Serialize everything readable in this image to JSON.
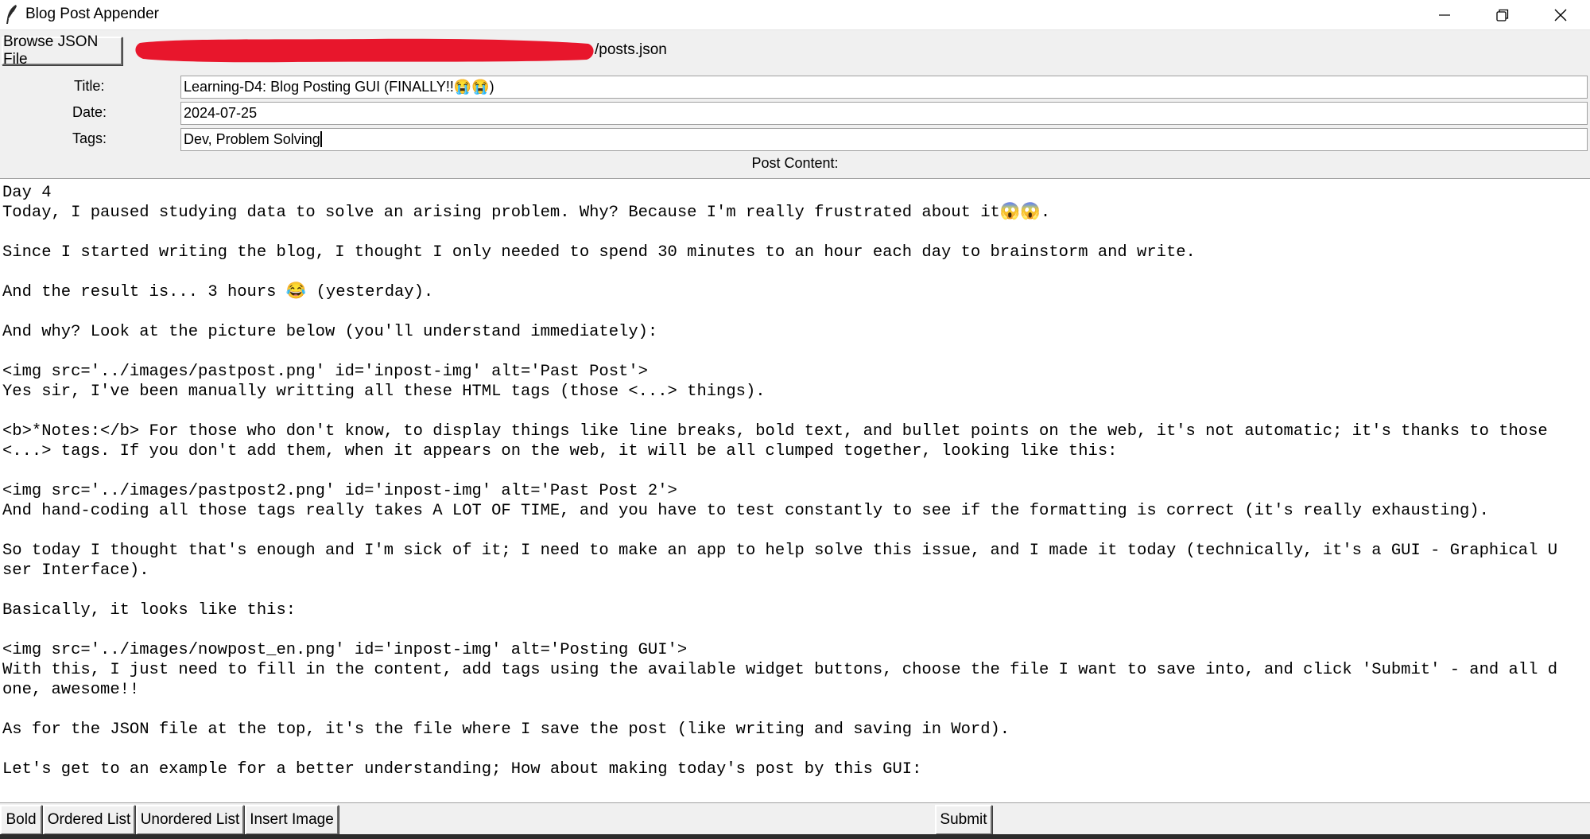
{
  "window": {
    "title": "Blog Post Appender",
    "icon": "feather-icon",
    "controls": [
      "minimize-icon",
      "restore-icon",
      "close-icon"
    ]
  },
  "file": {
    "browse_label": "Browse JSON File",
    "path_suffix": "/posts.json",
    "redaction_color": "#e8162c"
  },
  "form": {
    "title_label": "Title:",
    "title_value": "Learning-D4: Blog Posting GUI (FINALLY!!😭😭)",
    "date_label": "Date:",
    "date_value": "2024-07-25",
    "tags_label": "Tags:",
    "tags_value": "Dev, Problem Solving"
  },
  "content": {
    "label": "Post Content:",
    "lines": [
      "Day 4",
      "Today, I paused studying data to solve an arising problem. Why? Because I'm really frustrated about it😱😱.",
      "",
      "Since I started writing the blog, I thought I only needed to spend 30 minutes to an hour each day to brainstorm and write.",
      "",
      "And the result is... 3 hours 😂 (yesterday).",
      "",
      "And why? Look at the picture below (you'll understand immediately):",
      "",
      "<img src='../images/pastpost.png' id='inpost-img' alt='Past Post'>",
      "Yes sir, I've been manually writting all these HTML tags (those <...> things).",
      "",
      "<b>*Notes:</b> For those who don't know, to display things like line breaks, bold text, and bullet points on the web, it's not automatic; it's thanks to those",
      "<...> tags. If you don't add them, when it appears on the web, it will be all clumped together, looking like this:",
      "",
      "<img src='../images/pastpost2.png' id='inpost-img' alt='Past Post 2'>",
      "And hand-coding all those tags really takes A LOT OF TIME, and you have to test constantly to see if the formatting is correct (it's really exhausting).",
      "",
      "So today I thought that's enough and I'm sick of it; I need to make an app to help solve this issue, and I made it today (technically, it's a GUI - Graphical U",
      "ser Interface).",
      "",
      "Basically, it looks like this:",
      "",
      "<img src='../images/nowpost_en.png' id='inpost-img' alt='Posting GUI'>",
      "With this, I just need to fill in the content, add tags using the available widget buttons, choose the file I want to save into, and click 'Submit' - and all d",
      "one, awesome!!",
      "",
      "As for the JSON file at the top, it's the file where I save the post (like writing and saving in Word).",
      "",
      "Let's get to an example for a better understanding; How about making today's post by this GUI:"
    ]
  },
  "toolbar": {
    "bold_label": "Bold",
    "ordered_label": "Ordered List",
    "unordered_label": "Unordered List",
    "insert_image_label": "Insert Image",
    "submit_label": "Submit"
  }
}
